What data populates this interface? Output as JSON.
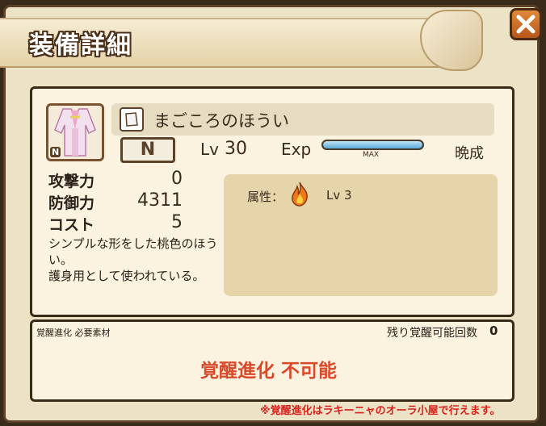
{
  "header": {
    "title": "装備詳細"
  },
  "item": {
    "name": "まごころのほうい",
    "rarity": "N",
    "rarity_badge": "N",
    "level_label": "Lv",
    "level": "30",
    "exp_label": "Exp",
    "exp_fraction": 1.0,
    "exp_max_label": "MAX",
    "status": "晩成"
  },
  "stats": [
    {
      "label": "攻撃力",
      "value": "0"
    },
    {
      "label": "防御力",
      "value": "4311"
    },
    {
      "label": "コスト",
      "value": "5"
    }
  ],
  "description": "シンプルな形をした桃色のほうい。\n護身用として使われている。",
  "attribute": {
    "label": "属性：",
    "icon": "fire-icon",
    "level": "Lv 3"
  },
  "awakening": {
    "materials_label": "覚醒進化 必要素材",
    "remaining_label": "残り覚醒可能回数",
    "remaining_value": "0",
    "status": "覚醒進化 不可能",
    "footnote": "※覚醒進化はラキーニャのオーラ小屋で行えます。"
  },
  "colors": {
    "accent_red": "#d84a2a",
    "close_button": "#c86a2a"
  }
}
